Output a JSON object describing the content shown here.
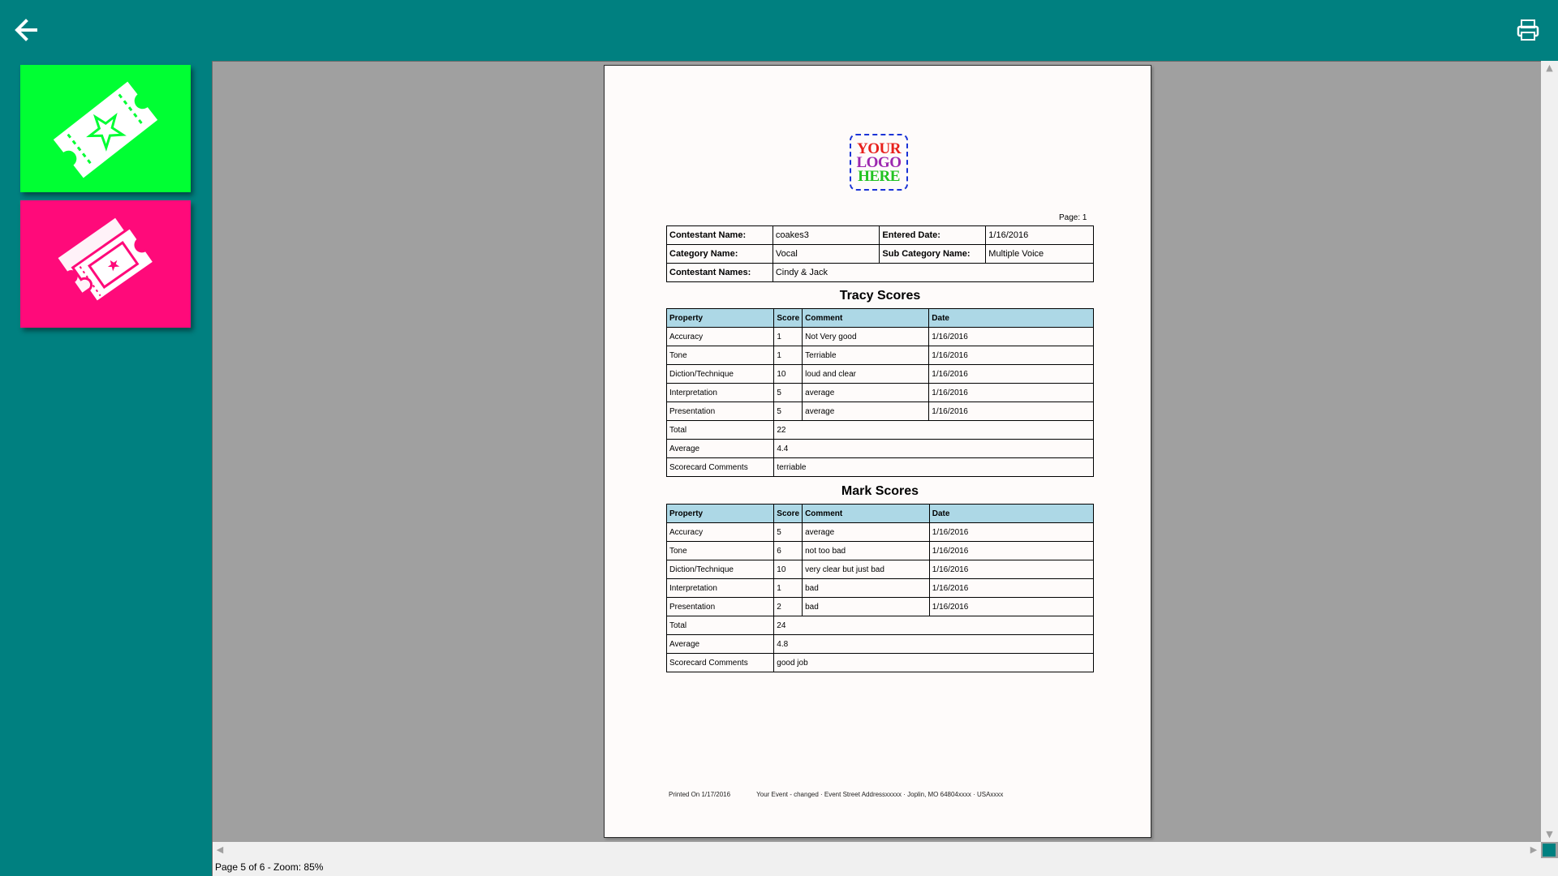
{
  "toolbar": {
    "back_icon": "arrow-left-icon",
    "print_icon": "printer-icon"
  },
  "tiles": [
    {
      "name": "ticket-star",
      "color": "#00ff33",
      "icon": "ticket-star-icon"
    },
    {
      "name": "tickets",
      "color": "#ff0a7a",
      "icon": "tickets-icon"
    }
  ],
  "report": {
    "logo": {
      "line1": "YOUR",
      "line2": "LOGO",
      "line3": "HERE"
    },
    "page_label": "Page: 1",
    "info": {
      "contestant_name_label": "Contestant Name:",
      "contestant_name": "coakes3",
      "entered_date_label": "Entered Date:",
      "entered_date": "1/16/2016",
      "category_label": "Category Name:",
      "category": "Vocal",
      "subcategory_label": "Sub Category Name:",
      "subcategory": "Multiple Voice",
      "contestants_label": "Contestant Names:",
      "contestants": "Cindy & Jack"
    },
    "headers": {
      "property": "Property",
      "score": "Score",
      "comment": "Comment",
      "date": "Date"
    },
    "summary_labels": {
      "total": "Total",
      "average": "Average",
      "comments": "Scorecard Comments"
    },
    "tracy": {
      "title": "Tracy Scores",
      "rows": [
        {
          "property": "Accuracy",
          "score": "1",
          "comment": "Not Very good",
          "date": "1/16/2016"
        },
        {
          "property": "Tone",
          "score": "1",
          "comment": "Terriable",
          "date": "1/16/2016"
        },
        {
          "property": "Diction/Technique",
          "score": "10",
          "comment": "loud and clear",
          "date": "1/16/2016"
        },
        {
          "property": "Interpretation",
          "score": "5",
          "comment": "average",
          "date": "1/16/2016"
        },
        {
          "property": "Presentation",
          "score": "5",
          "comment": "average",
          "date": "1/16/2016"
        }
      ],
      "total": "22",
      "average": "4.4",
      "comments": "terriable"
    },
    "mark": {
      "title": "Mark Scores",
      "rows": [
        {
          "property": "Accuracy",
          "score": "5",
          "comment": "average",
          "date": "1/16/2016"
        },
        {
          "property": "Tone",
          "score": "6",
          "comment": "not too bad",
          "date": "1/16/2016"
        },
        {
          "property": "Diction/Technique",
          "score": "10",
          "comment": "very clear but just bad",
          "date": "1/16/2016"
        },
        {
          "property": "Interpretation",
          "score": "1",
          "comment": "bad",
          "date": "1/16/2016"
        },
        {
          "property": "Presentation",
          "score": "2",
          "comment": "bad",
          "date": "1/16/2016"
        }
      ],
      "total": "24",
      "average": "4.8",
      "comments": "good job"
    },
    "footer": {
      "printed": "Printed On 1/17/2016",
      "event": "Your Event - changed · Event Street Addressxxxxx · Joplin, MO 64804xxxx · USAxxxx"
    }
  },
  "status": {
    "text": "Page 5 of 6 - Zoom: 85%"
  },
  "colors": {
    "teal": "#008080",
    "header_blue": "#add8e6",
    "green": "#00ff33",
    "pink": "#ff0a7a"
  }
}
